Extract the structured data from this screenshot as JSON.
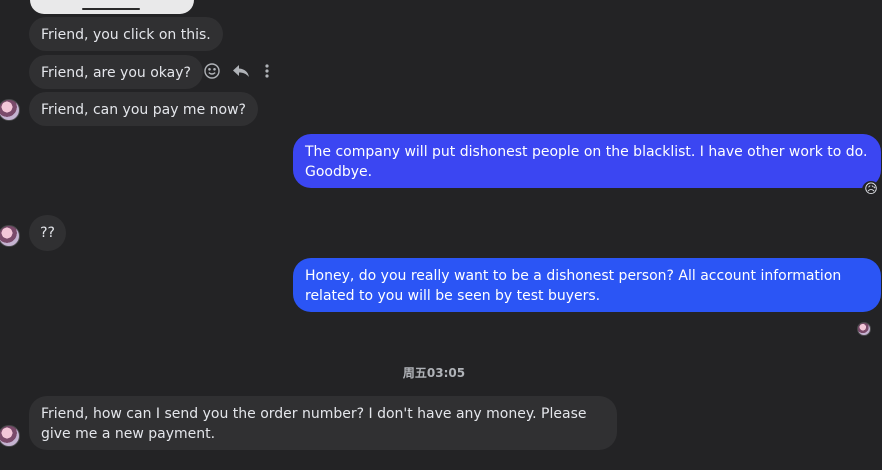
{
  "messages": [
    {
      "text": "Friend, you click on this."
    },
    {
      "text": "Friend, are you okay?"
    },
    {
      "text": "Friend, can you pay me now?"
    },
    {
      "text": "The company will put dishonest people on the blacklist. I have other work to do. Goodbye."
    },
    {
      "text": "??"
    },
    {
      "text": "Honey, do you really want to be a dishonest person? All account information related to you will be seen by test buyers."
    },
    {
      "text": "Friend, how can I send you the order number? I don't have any money. Please give me a new payment."
    }
  ],
  "timestamp": "周五03:05",
  "reaction": "😥",
  "icons": {
    "react": "smiley-face-icon",
    "reply": "reply-arrow-icon",
    "more": "more-vertical-icon"
  },
  "colors": {
    "background": "#232325",
    "incoming_bubble": "#303032",
    "outgoing_bubble_1": "#3b46f2",
    "outgoing_bubble_2": "#2b55f5"
  }
}
